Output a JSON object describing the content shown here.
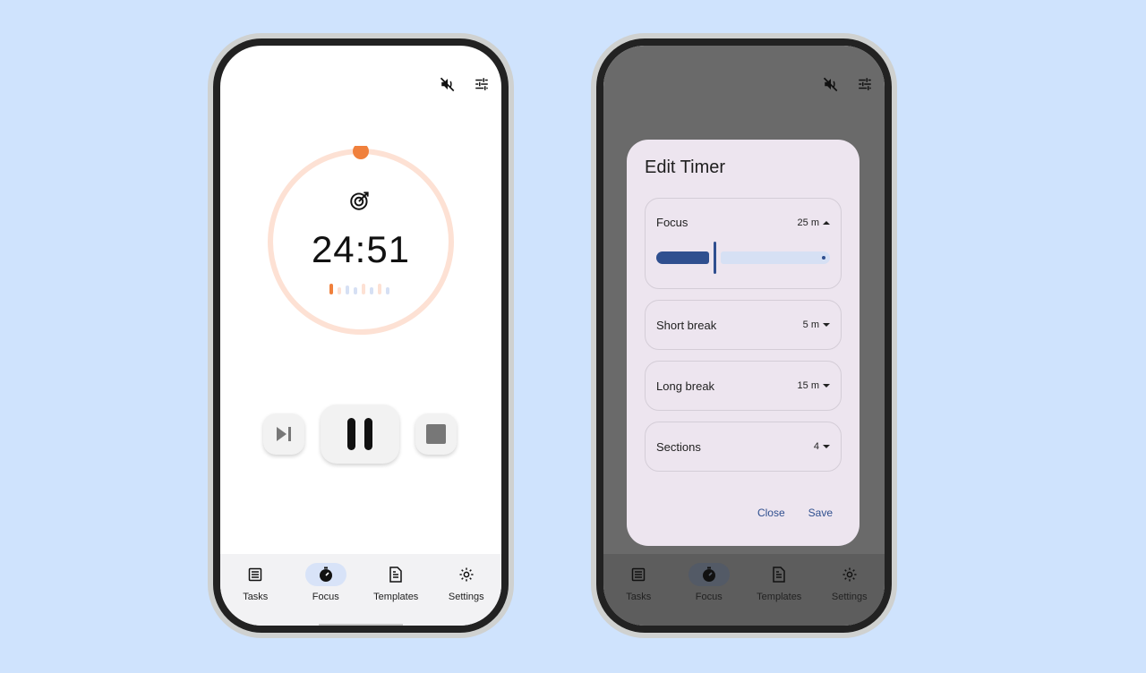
{
  "colors": {
    "background": "#cfe3fd",
    "accent_orange": "#f0803c",
    "ring_track": "#fde1d4",
    "primary_blue": "#2f4f8f",
    "nav_active": "#d8e3f8",
    "dialog_bg": "#ede5ef"
  },
  "left_screen": {
    "topbar": {
      "mute_icon": "volume-off-icon",
      "settings_icon": "tune-icon"
    },
    "timer": {
      "time": "24:51",
      "mode_icon": "target-icon",
      "progress": 0.0,
      "section_dots": {
        "total": 7,
        "current": 1
      }
    },
    "controls": {
      "skip_icon": "skip-next-icon",
      "pause_icon": "pause-icon",
      "stop_icon": "stop-icon"
    }
  },
  "nav": {
    "items": [
      {
        "label": "Tasks",
        "icon": "list-icon"
      },
      {
        "label": "Focus",
        "icon": "timer-icon",
        "active": true
      },
      {
        "label": "Templates",
        "icon": "document-icon"
      },
      {
        "label": "Settings",
        "icon": "gear-icon"
      }
    ]
  },
  "dialog": {
    "title": "Edit Timer",
    "rows": [
      {
        "label": "Focus",
        "value": "25 m",
        "expanded": true,
        "slider_fraction": 0.33
      },
      {
        "label": "Short break",
        "value": "5 m"
      },
      {
        "label": "Long break",
        "value": "15 m"
      },
      {
        "label": "Sections",
        "value": "4"
      }
    ],
    "close_label": "Close",
    "save_label": "Save"
  }
}
